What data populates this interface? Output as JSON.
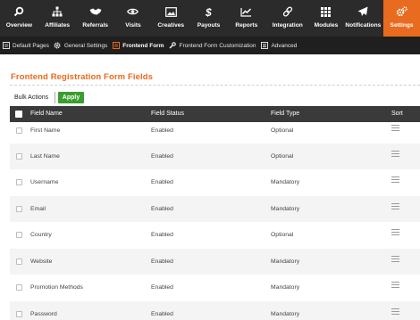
{
  "top_nav": {
    "items": [
      {
        "label": "Overview",
        "icon": "search-icon",
        "active": false
      },
      {
        "label": "Affiliates",
        "icon": "sitemap-icon",
        "active": false
      },
      {
        "label": "Referrals",
        "icon": "handshake-icon",
        "active": false
      },
      {
        "label": "Visits",
        "icon": "eye-icon",
        "active": false
      },
      {
        "label": "Creatives",
        "icon": "image-icon",
        "active": false
      },
      {
        "label": "Payouts",
        "icon": "dollar-icon",
        "active": false
      },
      {
        "label": "Reports",
        "icon": "line-chart-icon",
        "active": false
      },
      {
        "label": "Integration",
        "icon": "link-icon",
        "active": false
      },
      {
        "label": "Modules",
        "icon": "grid-icon",
        "active": false
      },
      {
        "label": "Notifications",
        "icon": "paper-plane-icon",
        "active": false
      },
      {
        "label": "Settings",
        "icon": "gears-icon",
        "active": true
      }
    ]
  },
  "sub_nav": {
    "items": [
      {
        "label": "Default Pages",
        "icon": "page-icon",
        "active": false
      },
      {
        "label": "General Settings",
        "icon": "gear-icon",
        "active": false
      },
      {
        "label": "Frontend Form",
        "icon": "form-icon",
        "active": true
      },
      {
        "label": "Frontend Form Customization",
        "icon": "wrench-icon",
        "active": false
      },
      {
        "label": "Advanced",
        "icon": "advanced-icon",
        "active": false
      }
    ]
  },
  "page": {
    "title": "Frontend Registration Form Fields",
    "bulk_actions": "Bulk Actions",
    "apply_label": "Apply"
  },
  "table": {
    "columns": [
      "Field Name",
      "Field Status",
      "Field Type",
      "Sort"
    ],
    "rows": [
      {
        "name": "First Name",
        "status": "Enabled",
        "type": "Optional"
      },
      {
        "name": "Last Name",
        "status": "Enabled",
        "type": "Optional"
      },
      {
        "name": "Username",
        "status": "Enabled",
        "type": "Mandatory"
      },
      {
        "name": "Email",
        "status": "Enabled",
        "type": "Mandatory"
      },
      {
        "name": "Country",
        "status": "Enabled",
        "type": "Optional"
      },
      {
        "name": "Website",
        "status": "Enabled",
        "type": "Mandatory"
      },
      {
        "name": "Promotion Methods",
        "status": "Enabled",
        "type": "Mandatory"
      },
      {
        "name": "Password",
        "status": "Enabled",
        "type": "Mandatory"
      }
    ]
  },
  "colors": {
    "nav_bg": "#2b2b2b",
    "subnav_bg": "#1f1f1f",
    "accent": "#e86b1f",
    "apply_green": "#3a9d2f",
    "header_bg": "#3a3a3a"
  }
}
